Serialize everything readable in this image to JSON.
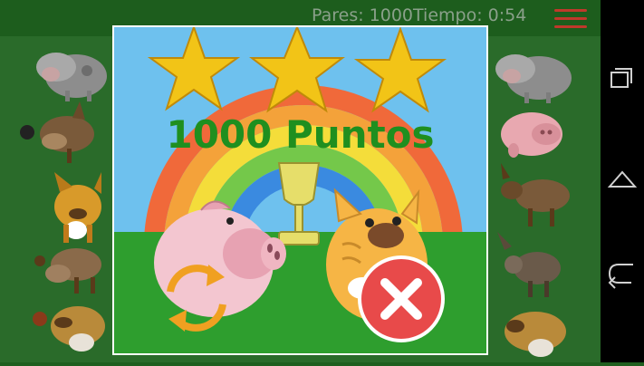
{
  "top_bar": {
    "status": "Pares: 1000Tiempo: 0:54"
  },
  "result_dialog": {
    "score_text": "1000 Puntos",
    "stars_earned": 3,
    "stars_total": 3
  },
  "colors": {
    "score_green": "#1f8f1f",
    "star_gold": "#f2c417",
    "sky_blue": "#6ec1ee",
    "grass_green": "#2e9e2e",
    "close_red": "#e84a4a",
    "replay_orange": "#f0a021"
  },
  "icons": [
    "menu-icon",
    "trophy-icon",
    "replay-icon",
    "close-icon",
    "recent-apps-icon",
    "home-icon",
    "back-icon"
  ],
  "board": {
    "left_cards": [
      "cow",
      "donkey",
      "cat",
      "donkey",
      "dog"
    ],
    "right_cards": [
      "cow",
      "pig",
      "donkey",
      "donkey",
      "dog"
    ]
  }
}
